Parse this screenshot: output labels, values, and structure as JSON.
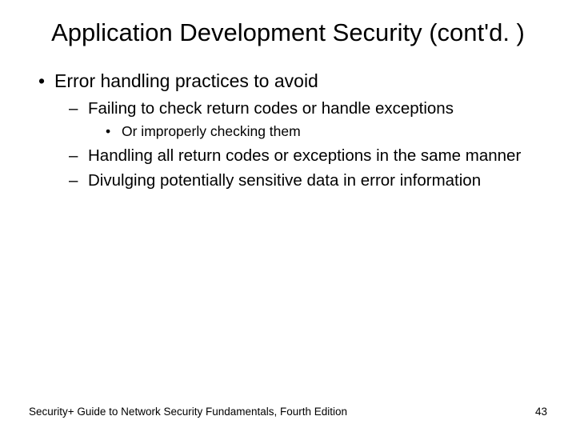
{
  "title": "Application Development Security (cont'd. )",
  "bullets": {
    "b1": "Error handling practices to avoid",
    "b1_1": "Failing to check return codes or handle exceptions",
    "b1_1_1": "Or improperly checking them",
    "b1_2": "Handling all return codes or exceptions in the same manner",
    "b1_3": "Divulging potentially sensitive data in error information"
  },
  "footer": {
    "text": "Security+ Guide to Network Security Fundamentals, Fourth Edition",
    "page": "43"
  }
}
